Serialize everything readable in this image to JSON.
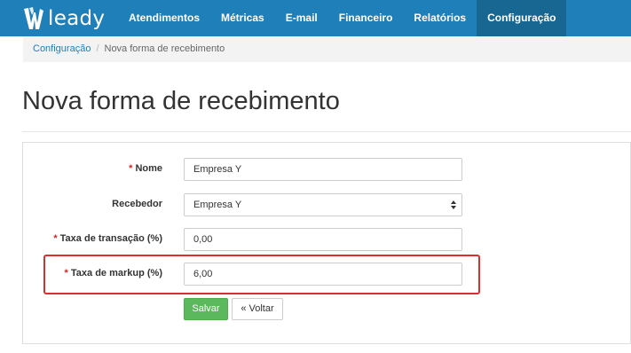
{
  "brand": {
    "name": "leady"
  },
  "nav": {
    "items": [
      {
        "label": "Atendimentos"
      },
      {
        "label": "Métricas"
      },
      {
        "label": "E-mail"
      },
      {
        "label": "Financeiro"
      },
      {
        "label": "Relatórios"
      },
      {
        "label": "Configuração",
        "active": true
      }
    ]
  },
  "breadcrumb": {
    "parent": "Configuração",
    "separator": "/",
    "current": "Nova forma de recebimento"
  },
  "page": {
    "title": "Nova forma de recebimento"
  },
  "form": {
    "required_marker": "*",
    "fields": [
      {
        "label": "Nome",
        "required": true,
        "value": "Empresa Y"
      },
      {
        "label": "Recebedor",
        "required": false,
        "value": "Empresa Y",
        "type": "select"
      },
      {
        "label": "Taxa de transação (%)",
        "required": true,
        "value": "0,00"
      },
      {
        "label": "Taxa de markup (%)",
        "required": true,
        "value": "6,00",
        "highlighted": true
      }
    ],
    "save_label": "Salvar",
    "back_label": "« Voltar"
  },
  "colors": {
    "navbar": "#1f7fb8",
    "navbar_active": "#176792",
    "save_button": "#5cb85c",
    "highlight_border": "#d9302f",
    "required": "#e02020"
  }
}
